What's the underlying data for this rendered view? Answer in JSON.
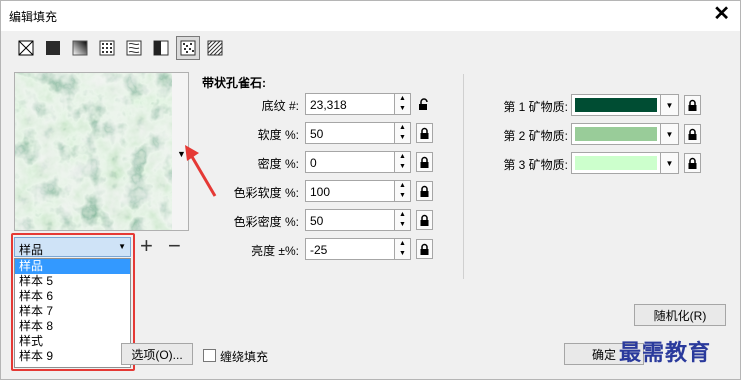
{
  "window": {
    "title": "编辑填充",
    "close_glyph": "✕"
  },
  "toolbar": {
    "tools": [
      {
        "name": "no-fill",
        "active": false
      },
      {
        "name": "uniform-fill",
        "active": false
      },
      {
        "name": "fountain-fill",
        "active": false
      },
      {
        "name": "vector-pattern-fill",
        "active": false
      },
      {
        "name": "bitmap-pattern-fill",
        "active": false
      },
      {
        "name": "two-color-pattern-fill",
        "active": false
      },
      {
        "name": "texture-fill",
        "active": true
      },
      {
        "name": "postscript-fill",
        "active": false
      }
    ]
  },
  "preview": {
    "icon": "chevron-down-icon",
    "arrow_glyph": "▼"
  },
  "library": {
    "selected": "样品",
    "arrow_glyph": "▼",
    "add_glyph": "+",
    "remove_glyph": "−",
    "options": [
      "样品",
      "样本 5",
      "样本 6",
      "样本 7",
      "样本 8",
      "样式",
      "样本 9"
    ]
  },
  "texture": {
    "name": "带状孔雀石:",
    "up_glyph": "▲",
    "down_glyph": "▼",
    "params": [
      {
        "label": "底纹 #:",
        "value": "23,318",
        "locked": false
      },
      {
        "label": "软度 %:",
        "value": "50",
        "locked": true
      },
      {
        "label": "密度 %:",
        "value": "0",
        "locked": true
      },
      {
        "label": "色彩软度 %:",
        "value": "100",
        "locked": true
      },
      {
        "label": "色彩密度 %:",
        "value": "50",
        "locked": true
      },
      {
        "label": "亮度 ±%:",
        "value": "-25",
        "locked": true
      }
    ]
  },
  "materials": {
    "dd_glyph": "▼",
    "items": [
      {
        "label": "第 1 矿物质:",
        "color": "#004d33"
      },
      {
        "label": "第 2 矿物质:",
        "color": "#99cc99"
      },
      {
        "label": "第 3 矿物质:",
        "color": "#ccffcc"
      }
    ]
  },
  "buttons": {
    "randomize": "随机化(R)",
    "options": "选项(O)...",
    "tile_label": "缠绕填充",
    "ok": "确定"
  },
  "watermark": "最需教育",
  "colors": {
    "selection": "#3399ff",
    "highlight_box": "#e53935",
    "annotation_arrow": "#e53935"
  }
}
